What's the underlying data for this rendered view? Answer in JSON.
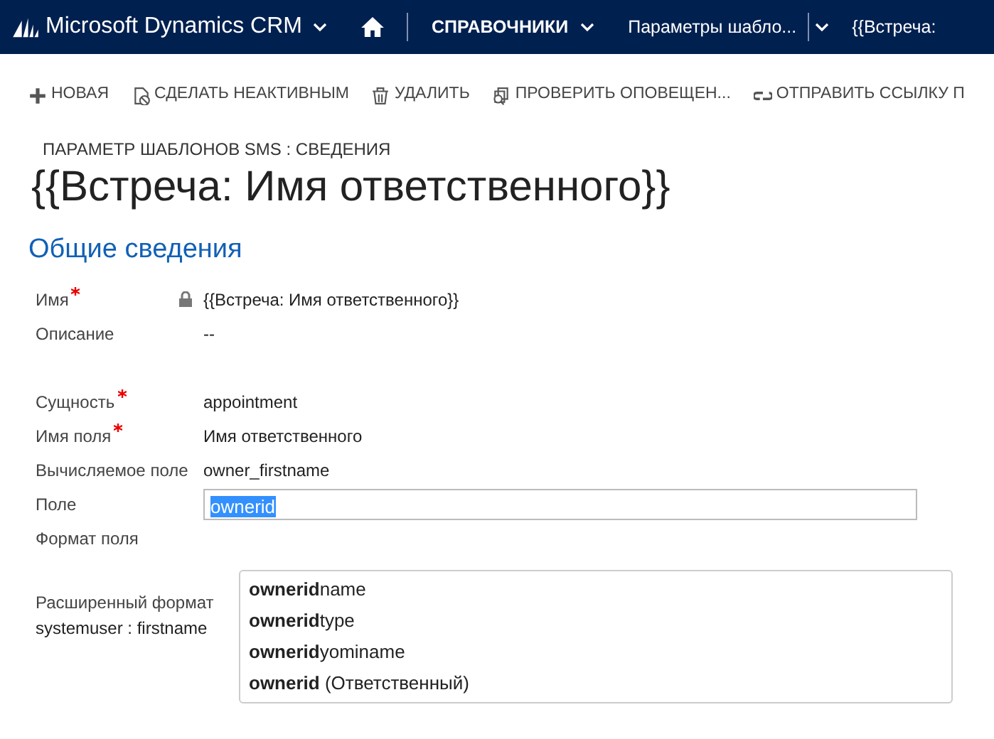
{
  "navbar": {
    "app_title": "Microsoft Dynamics CRM",
    "area": "СПРАВОЧНИКИ",
    "entity": "Параметры шабло...",
    "record": "{{Встреча:"
  },
  "toolbar": [
    {
      "kind": "plus",
      "label": "НОВАЯ"
    },
    {
      "kind": "deactivate",
      "label": "СДЕЛАТЬ НЕАКТИВНЫМ"
    },
    {
      "kind": "trash",
      "label": "УДАЛИТЬ"
    },
    {
      "kind": "check",
      "label": "ПРОВЕРИТЬ ОПОВЕЩЕН..."
    },
    {
      "kind": "link",
      "label": "ОТПРАВИТЬ ССЫЛКУ П"
    }
  ],
  "header": {
    "entity_label": "ПАРАМЕТР ШАБЛОНОВ SMS : СВЕДЕНИЯ",
    "title": "{{Встреча: Имя ответственного}}"
  },
  "section": {
    "title": "Общие сведения"
  },
  "field_groups": [
    [
      {
        "label": "Имя",
        "required": true,
        "locked": true,
        "value": "{{Встреча: Имя ответственного}}"
      },
      {
        "label": "Описание",
        "required": false,
        "locked": false,
        "value": "--"
      }
    ],
    [
      {
        "label": "Сущность",
        "required": true,
        "locked": false,
        "value": "appointment"
      },
      {
        "label": "Имя поля",
        "required": true,
        "locked": false,
        "value": "Имя ответственного"
      },
      {
        "label": "Вычисляемое поле",
        "required": false,
        "locked": false,
        "value": "owner_firstname"
      },
      {
        "label": "Поле",
        "required": false,
        "locked": false,
        "kind": "input",
        "value": "ownerid",
        "text_selected": true
      },
      {
        "label": "Формат поля",
        "required": false,
        "locked": false
      }
    ],
    [
      {
        "label": "Расширенный формат",
        "sublabel": "systemuser : firstname",
        "required": false,
        "locked": false
      }
    ]
  ],
  "suggestions": [
    "**ownerid**name",
    "**ownerid**type",
    "**ownerid**yominame",
    "**ownerid** (Ответственный)"
  ]
}
